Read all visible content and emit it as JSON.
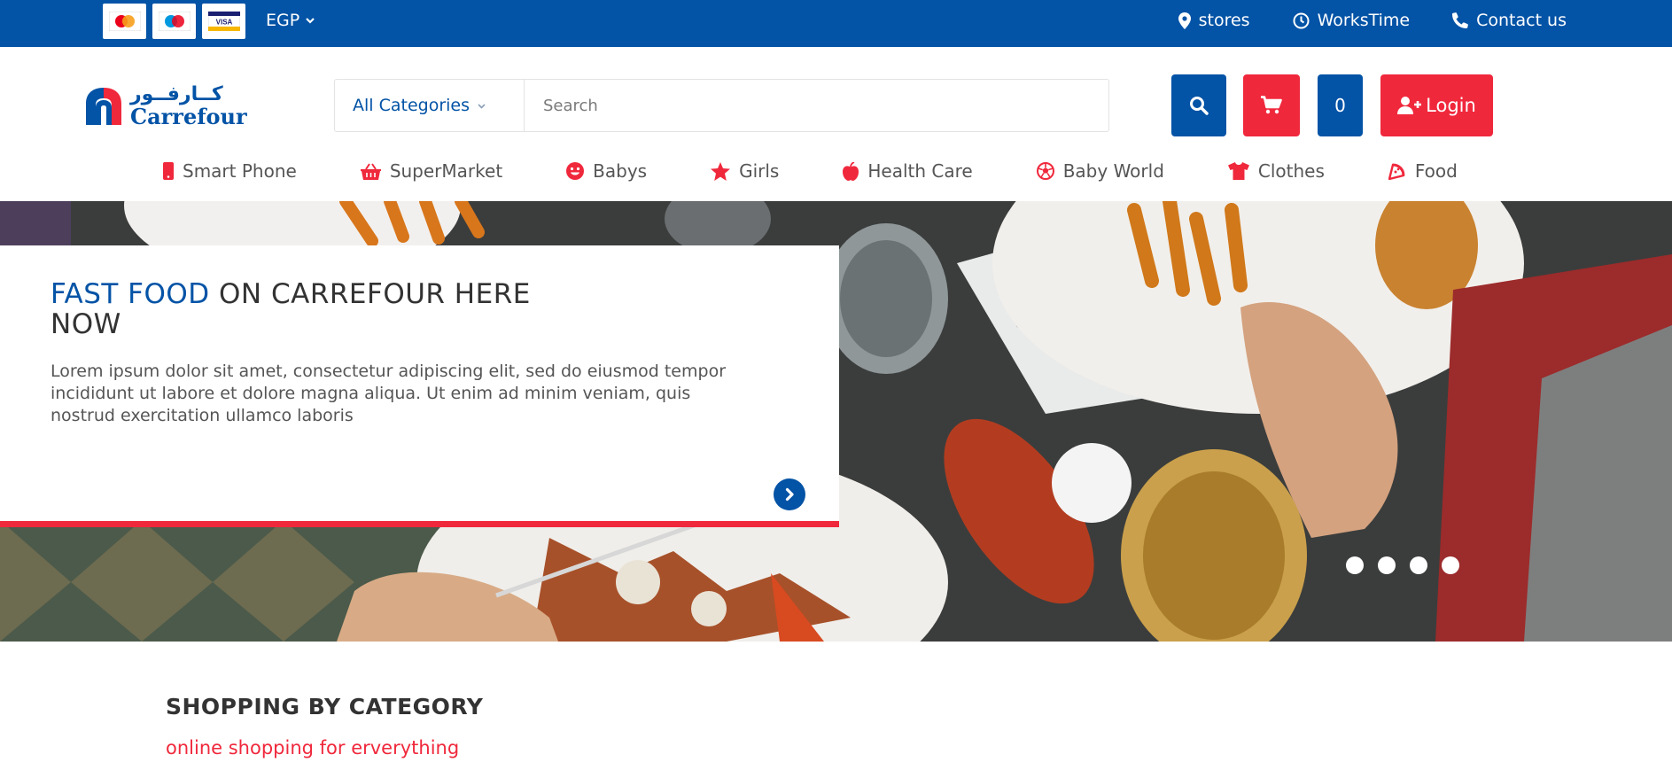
{
  "topbar": {
    "payment_cards": [
      "MasterCard",
      "Maestro",
      "VISA"
    ],
    "currency": "EGP",
    "links": [
      {
        "label": "stores",
        "icon": "location-pin-icon"
      },
      {
        "label": "WorksTime",
        "icon": "clock-icon"
      },
      {
        "label": "Contact us",
        "icon": "phone-icon"
      }
    ]
  },
  "header": {
    "logo_ar": "كــارفــور",
    "logo_en": "Carrefour",
    "category_select": "All Categories",
    "search_placeholder": "Search",
    "cart_count": "0",
    "login_label": "Login"
  },
  "nav": {
    "items": [
      {
        "label": "Smart Phone",
        "icon": "mobile-icon"
      },
      {
        "label": "SuperMarket",
        "icon": "basket-icon"
      },
      {
        "label": "Babys",
        "icon": "smile-icon"
      },
      {
        "label": "Girls",
        "icon": "star-icon"
      },
      {
        "label": "Health Care",
        "icon": "apple-icon"
      },
      {
        "label": "Baby World",
        "icon": "ball-icon"
      },
      {
        "label": "Clothes",
        "icon": "shirt-icon"
      },
      {
        "label": "Food",
        "icon": "pizza-icon"
      }
    ]
  },
  "hero": {
    "title_highlight": "FAST FOOD",
    "title_rest": "ON CARREFOUR HERE NOW",
    "text": "Lorem ipsum dolor sit amet, consectetur adipiscing elit, sed do eiusmod tempor incididunt ut labore et dolore magna aliqua. Ut enim ad minim veniam, quis nostrud exercitation ullamco laboris",
    "slide_count": 4
  },
  "section": {
    "title": "SHOPPING BY CATEGORY",
    "subtitle": "online shopping for erverything"
  },
  "colors": {
    "brand_blue": "#0353a6",
    "brand_red": "#f0283c"
  }
}
